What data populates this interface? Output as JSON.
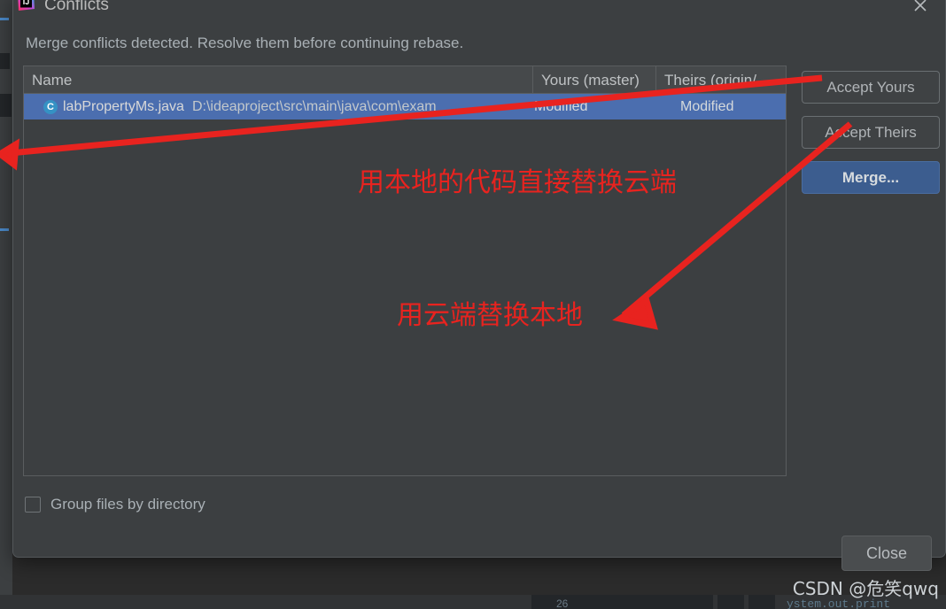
{
  "window": {
    "title": "Conflicts",
    "app_icon": "intellij-idea-logo-icon",
    "close_icon": "close-icon",
    "description": "Merge conflicts detected. Resolve them before continuing rebase."
  },
  "table": {
    "columns": [
      {
        "key": "name",
        "label": "Name"
      },
      {
        "key": "yours",
        "label": "Yours (master)"
      },
      {
        "key": "theirs",
        "label": "Theirs (origin/..."
      }
    ],
    "rows": [
      {
        "icon": "java-class-icon",
        "icon_letter": "C",
        "file_name": "labPropertyMs.java",
        "file_path": "D:\\ideaproject\\src\\main\\java\\com\\exam",
        "yours": "Modified",
        "theirs": "Modified",
        "selected": true
      }
    ]
  },
  "side_buttons": [
    {
      "id": "accept-yours",
      "label": "Accept Yours",
      "style": "outline"
    },
    {
      "id": "accept-theirs",
      "label": "Accept Theirs",
      "style": "outline"
    },
    {
      "id": "merge",
      "label": "Merge...",
      "style": "primary"
    }
  ],
  "options": {
    "group_by_directory": {
      "label": "Group files by directory",
      "checked": false
    }
  },
  "footer": {
    "close_label": "Close"
  },
  "annotations": [
    {
      "id": "anno-1",
      "text": "用本地的代码直接替换云端"
    },
    {
      "id": "anno-2",
      "text": "用云端替换本地"
    }
  ],
  "watermark": "CSDN @危笑qwq",
  "background": {
    "console_text": "ystem.out.print",
    "line_number": "26"
  },
  "colors": {
    "dialog_bg": "#3c3f41",
    "header_bg": "#46494b",
    "selection_blue": "#4b6eaf",
    "primary_button": "#3c5d8f",
    "annotation_red": "#e8231f",
    "class_icon_blue": "#3592c4",
    "text_primary": "#a9b0b5"
  }
}
